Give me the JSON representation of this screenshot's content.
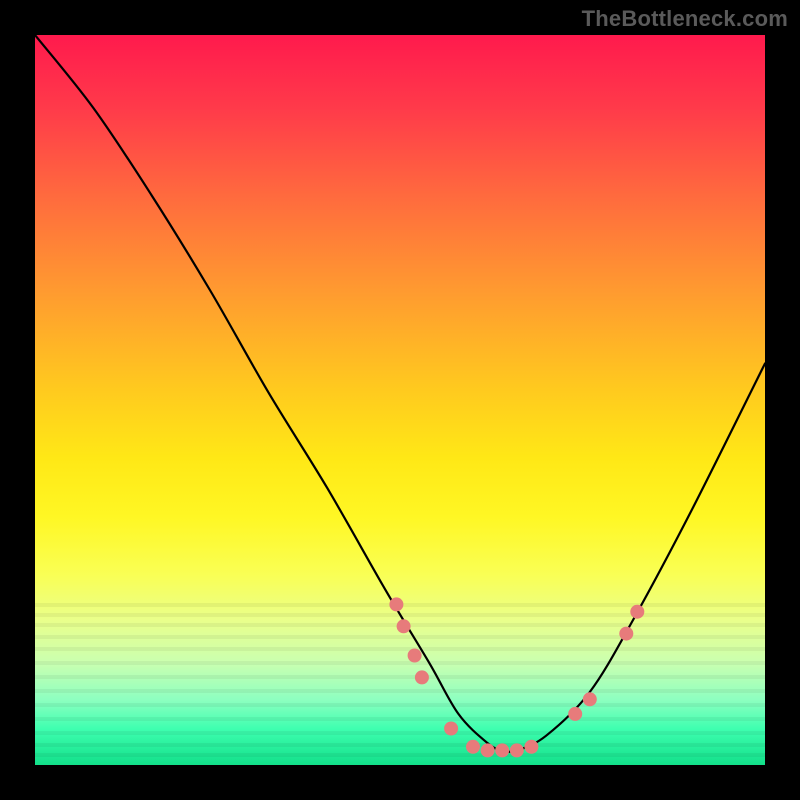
{
  "watermark": "TheBottleneck.com",
  "chart_data": {
    "type": "line",
    "title": "",
    "xlabel": "",
    "ylabel": "",
    "xlim": [
      0,
      100
    ],
    "ylim": [
      0,
      100
    ],
    "grid": false,
    "legend": false,
    "series": [
      {
        "name": "bottleneck-curve",
        "color": "#000000",
        "x": [
          0,
          8,
          16,
          24,
          32,
          40,
          48,
          54,
          58,
          62,
          64,
          66,
          70,
          76,
          82,
          90,
          100
        ],
        "y": [
          100,
          90,
          78,
          65,
          51,
          38,
          24,
          14,
          7,
          3,
          2,
          2,
          4,
          10,
          20,
          35,
          55
        ]
      }
    ],
    "markers": {
      "name": "highlight-points",
      "color": "#e77b7b",
      "radius": 7,
      "x": [
        49.5,
        50.5,
        52,
        53,
        57,
        60,
        62,
        64,
        66,
        68,
        74,
        76,
        81,
        82.5
      ],
      "y": [
        22,
        19,
        15,
        12,
        5,
        2.5,
        2,
        2,
        2,
        2.5,
        7,
        9,
        18,
        21
      ]
    }
  }
}
